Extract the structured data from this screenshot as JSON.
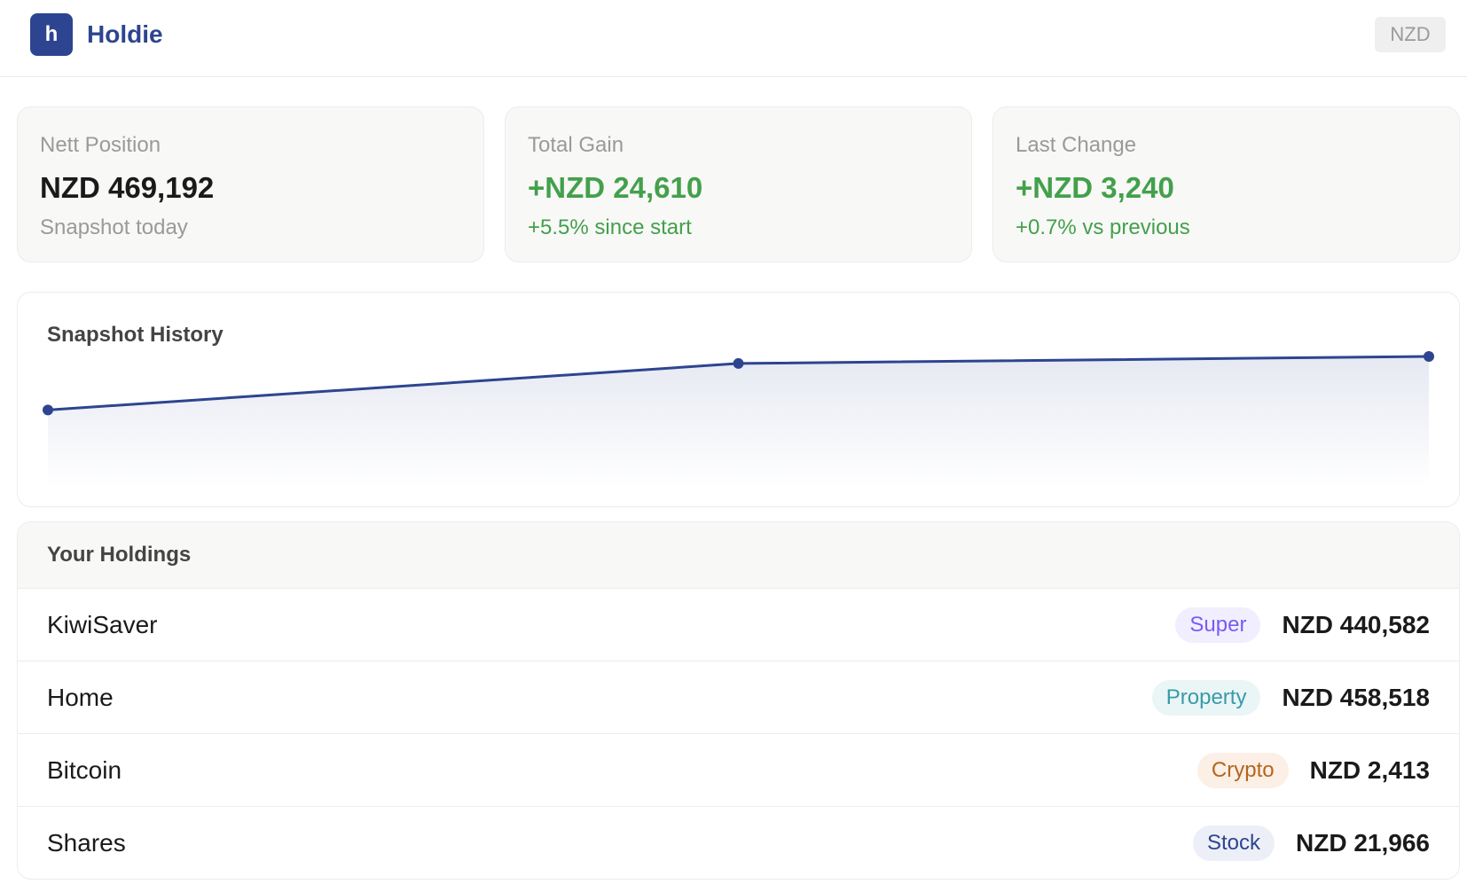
{
  "header": {
    "logo_letter": "h",
    "brand": "Holdie",
    "currency": "NZD"
  },
  "stats": [
    {
      "label": "Nett Position",
      "value": "NZD 469,192",
      "sub": "Snapshot today"
    },
    {
      "label": "Total Gain",
      "value": "+NZD 24,610",
      "sub": "+5.5% since start"
    },
    {
      "label": "Last Change",
      "value": "+NZD 3,240",
      "sub": "+0.7% vs previous"
    }
  ],
  "chart": {
    "title": "Snapshot History"
  },
  "chart_data": {
    "type": "area",
    "title": "Snapshot History",
    "x": [
      1,
      2,
      3
    ],
    "series": [
      {
        "values": [
          444582,
          465952,
          469192
        ]
      }
    ],
    "ylim": [
      415000,
      470000
    ],
    "grid": false,
    "color": "#2d4590"
  },
  "holdings": {
    "title": "Your Holdings",
    "items": [
      {
        "name": "KiwiSaver",
        "type": "Super",
        "amount": "NZD 440,582",
        "badge_bg": "#f1efff",
        "badge_color": "#7a5af5"
      },
      {
        "name": "Home",
        "type": "Property",
        "amount": "NZD 458,518",
        "badge_bg": "#eaf5f6",
        "badge_color": "#3a9aa8"
      },
      {
        "name": "Bitcoin",
        "type": "Crypto",
        "amount": "NZD 2,413",
        "badge_bg": "#fbefe6",
        "badge_color": "#b5651d"
      },
      {
        "name": "Shares",
        "type": "Stock",
        "amount": "NZD 21,966",
        "badge_bg": "#eceff7",
        "badge_color": "#2d4590"
      }
    ]
  },
  "colors": {
    "accent": "#2d4590",
    "positive": "#43a04b"
  }
}
